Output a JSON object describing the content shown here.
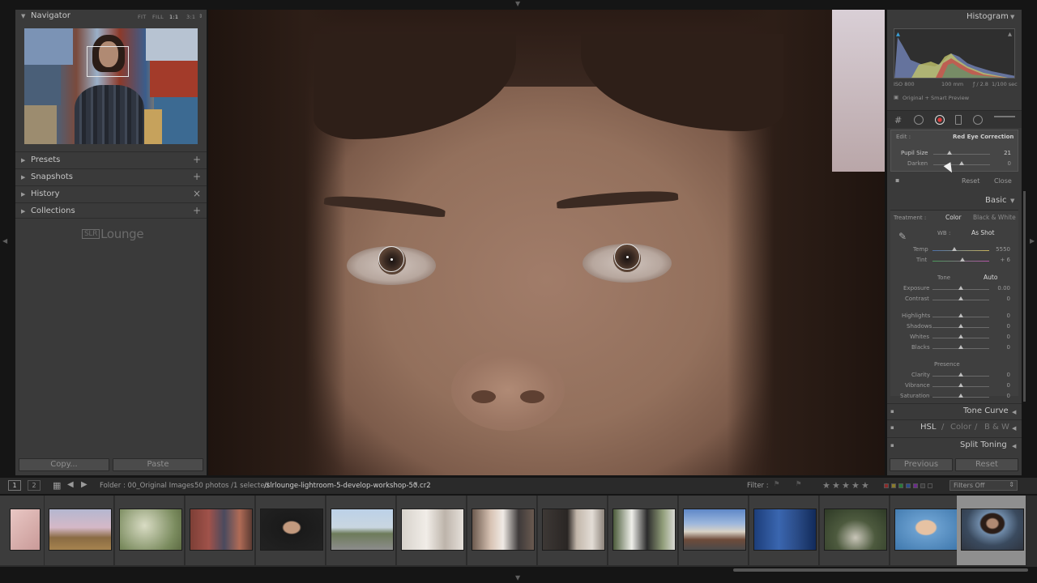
{
  "left_panel": {
    "navigator": {
      "title": "Navigator",
      "zoom_options": [
        "FIT",
        "FILL",
        "1:1",
        "3:1"
      ],
      "active_zoom": "1:1"
    },
    "sections": [
      {
        "label": "Presets",
        "action": "+"
      },
      {
        "label": "Snapshots",
        "action": "+"
      },
      {
        "label": "History",
        "action": "×"
      },
      {
        "label": "Collections",
        "action": "+"
      }
    ],
    "logo": {
      "bracket": "SLR",
      "name": "Lounge"
    },
    "copy_button": "Copy...",
    "paste_button": "Paste"
  },
  "right_panel": {
    "histogram": {
      "title": "Histogram",
      "iso": "ISO 800",
      "focal": "100 mm",
      "aperture": "ƒ / 2.8",
      "shutter": "1/100 sec",
      "preview_status": "Original + Smart Preview"
    },
    "red_eye": {
      "edit_label": "Edit :",
      "mode": "Red Eye Correction",
      "pupil_size_label": "Pupil Size",
      "pupil_size_value": "21",
      "pupil_size_level": 0.28,
      "darken_label": "Darken",
      "darken_value": "0",
      "darken_level": 0.5,
      "reset": "Reset",
      "close": "Close"
    },
    "basic": {
      "title": "Basic",
      "treatment_label": "Treatment :",
      "color": "Color",
      "bw": "Black & White",
      "wb_label": "WB :",
      "wb_value": "As Shot",
      "temp_label": "Temp",
      "temp_value": "5550",
      "tint_label": "Tint",
      "tint_value": "+ 6",
      "tone_label": "Tone",
      "auto": "Auto",
      "exposure_label": "Exposure",
      "exposure_value": "0.00",
      "contrast_label": "Contrast",
      "contrast_value": "0",
      "highlights_label": "Highlights",
      "highlights_value": "0",
      "shadows_label": "Shadows",
      "shadows_value": "0",
      "whites_label": "Whites",
      "whites_value": "0",
      "blacks_label": "Blacks",
      "blacks_value": "0",
      "presence_label": "Presence",
      "clarity_label": "Clarity",
      "clarity_value": "0",
      "vibrance_label": "Vibrance",
      "vibrance_value": "0",
      "saturation_label": "Saturation",
      "saturation_value": "0"
    },
    "tone_curve": "Tone Curve",
    "hsl": "HSL",
    "hsl_color": "Color",
    "hsl_bw": "B & W",
    "split_toning": "Split Toning",
    "previous_button": "Previous",
    "reset_button": "Reset"
  },
  "filmstrip": {
    "page1": "1",
    "page2": "2",
    "folder": "Folder : 00_Original Images",
    "count": "50 photos /1 selected",
    "filename": "/slrlounge-lightroom-5-develop-workshop-50.cr2",
    "filter_label": "Filter :",
    "filters_off": "Filters Off",
    "colors": {
      "accent": "#8f8f8f",
      "panel": "#3a3a3a",
      "background": "#151515"
    }
  }
}
